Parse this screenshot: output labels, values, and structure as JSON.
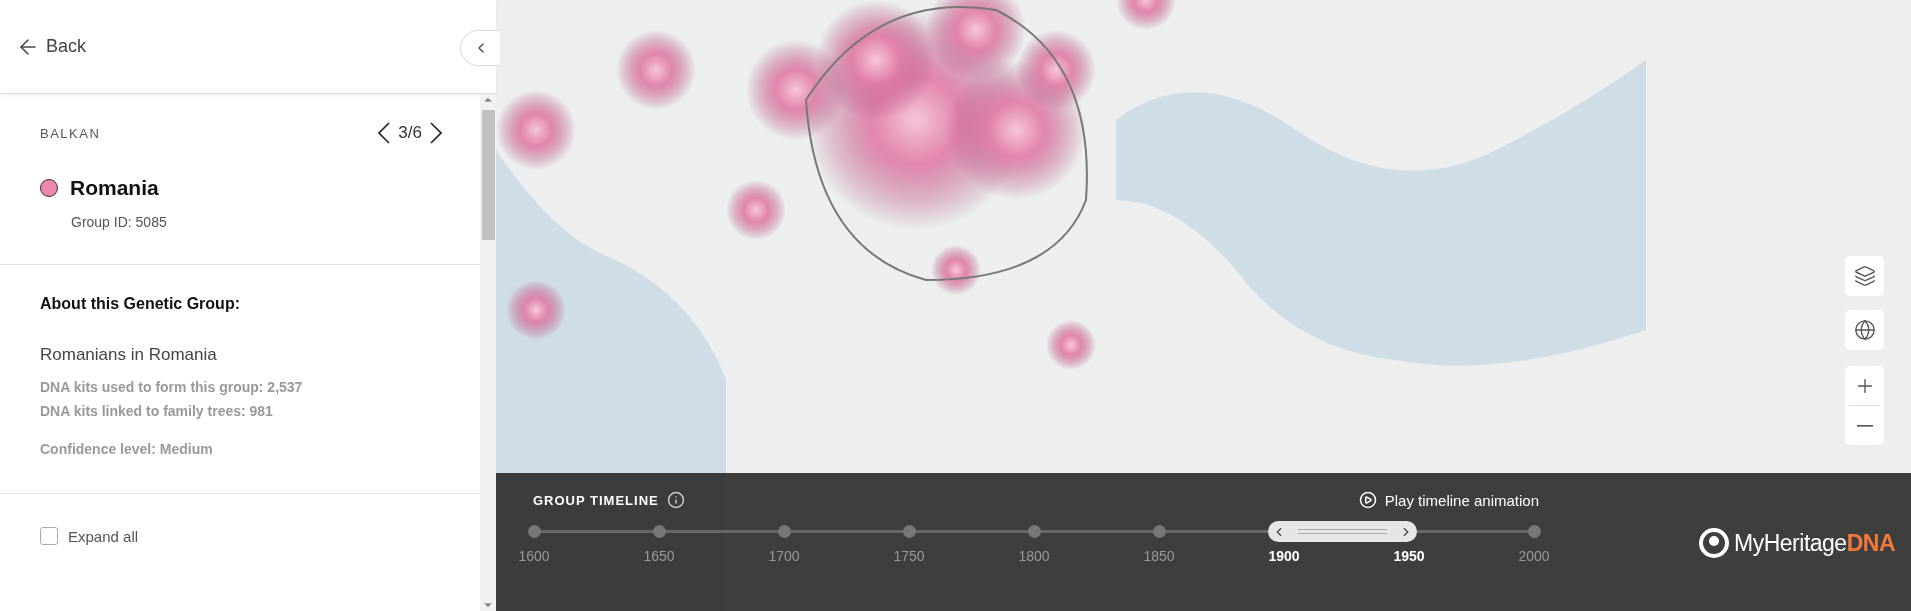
{
  "sidebar": {
    "back_label": "Back",
    "region": "BALKAN",
    "pager": "3/6",
    "group": {
      "name": "Romania",
      "color": "#ee86b0",
      "group_id": "Group ID: 5085"
    },
    "about": {
      "heading": "About this Genetic Group:",
      "description": "Romanians in Romania",
      "stats": [
        "DNA kits used to form this group: 2,537",
        "DNA kits linked to family trees: 981"
      ],
      "confidence": "Confidence level: Medium"
    },
    "expand_all": {
      "label": "Expand all",
      "checked": false
    }
  },
  "timeline": {
    "title": "GROUP TIMELINE",
    "play_label": "Play timeline animation",
    "ticks": [
      {
        "label": "1600",
        "selected": false
      },
      {
        "label": "1650",
        "selected": false
      },
      {
        "label": "1700",
        "selected": false
      },
      {
        "label": "1750",
        "selected": false
      },
      {
        "label": "1800",
        "selected": false
      },
      {
        "label": "1850",
        "selected": false
      },
      {
        "label": "1900",
        "selected": true
      },
      {
        "label": "1950",
        "selected": true
      },
      {
        "label": "2000",
        "selected": false
      }
    ]
  },
  "logo": {
    "name": "MyHeritage",
    "suffix": "DNA"
  }
}
